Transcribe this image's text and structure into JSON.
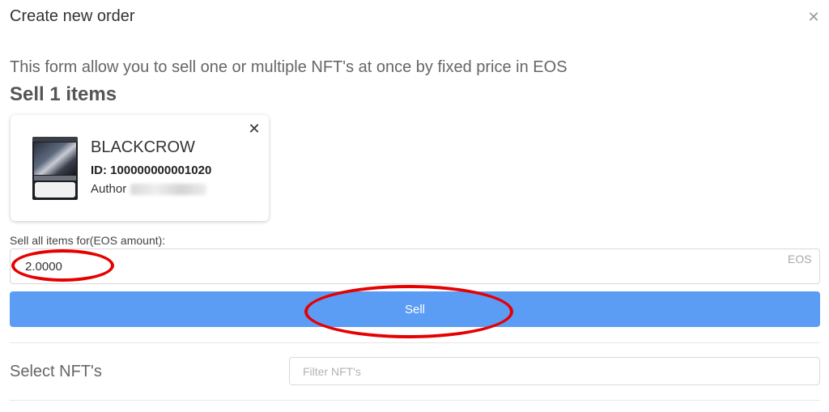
{
  "modal": {
    "title": "Create new order",
    "close_icon": "close-icon"
  },
  "intro": {
    "description": "This form allow you to sell one or multiple NFT's at once by fixed price in EOS",
    "sell_count": "Sell 1 items"
  },
  "nft": {
    "name": "BLACKCROW",
    "id": "ID: 100000000001020",
    "author_label": "Author",
    "thumbnail": "nft-card-artwork",
    "remove_icon": "close-icon"
  },
  "price": {
    "label": "Sell all items for(EOS amount):",
    "value": "2.0000",
    "suffix": "EOS"
  },
  "sell_button": {
    "label": "Sell",
    "color": "#5b9cf5"
  },
  "select": {
    "title": "Select NFT's",
    "filter_placeholder": "Filter NFT's"
  },
  "annotations": {
    "color": "#e60000"
  }
}
